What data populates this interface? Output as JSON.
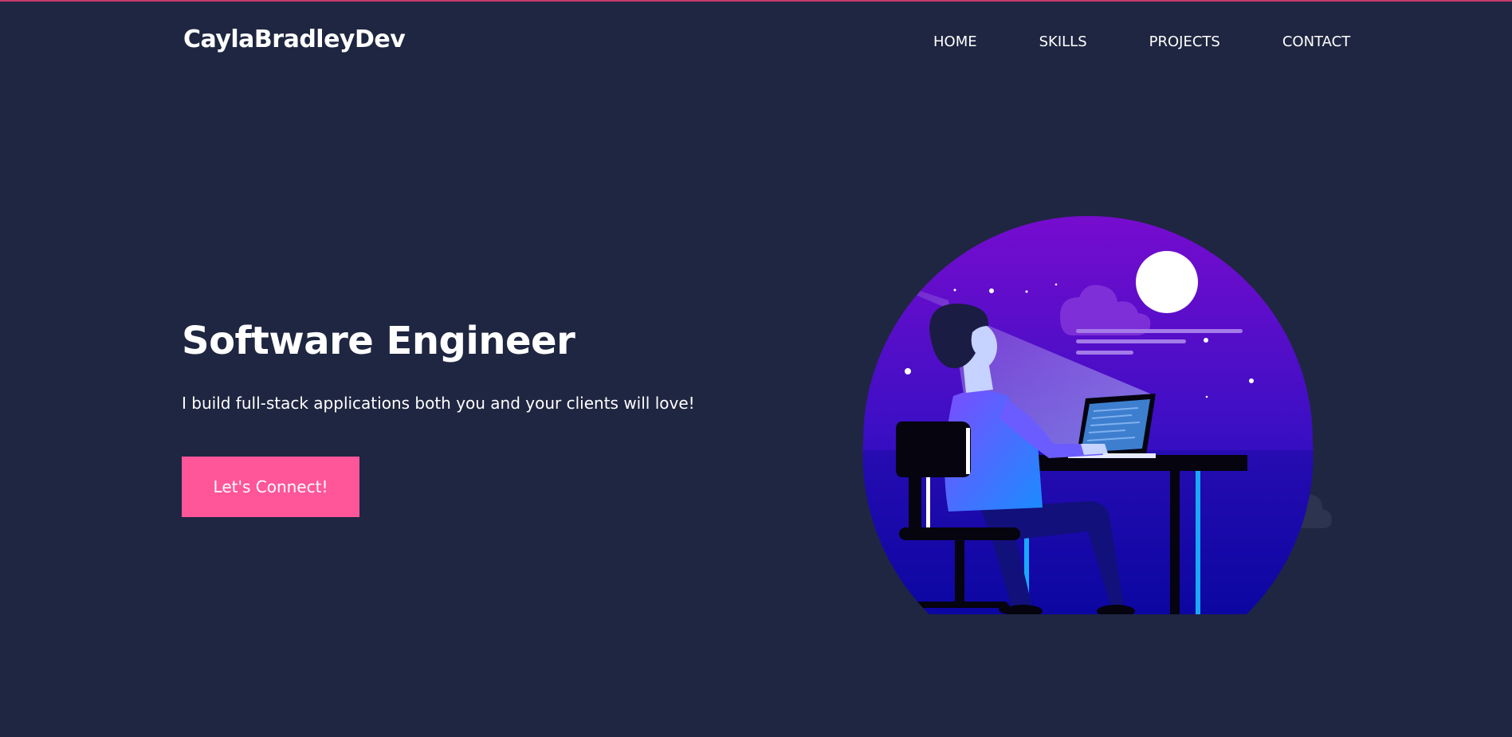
{
  "nav": {
    "logo": "CaylaBradleyDev",
    "links": [
      "HOME",
      "SKILLS",
      "PROJECTS",
      "CONTACT"
    ]
  },
  "hero": {
    "title": "Software Engineer",
    "subtitle": "I build full-stack applications both you and your clients will love!",
    "cta_label": "Let's Connect!"
  },
  "illustration": {
    "icon": "developer-at-desk-illustration"
  },
  "colors": {
    "background": "#1f2641",
    "accent": "#ff5599",
    "text": "#ffffff",
    "top_border": "#c43a6a"
  }
}
